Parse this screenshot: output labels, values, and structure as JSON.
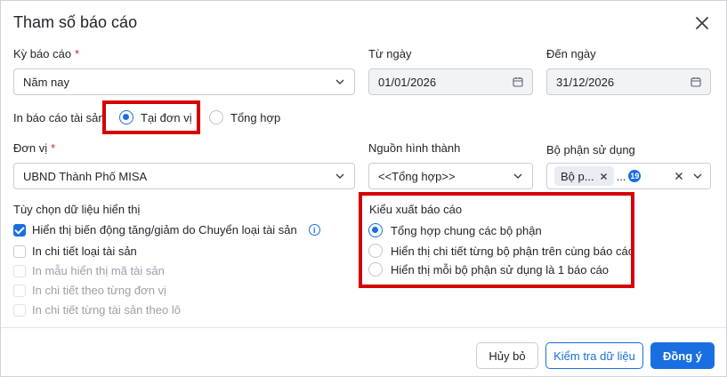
{
  "dialog": {
    "title": "Tham số báo cáo",
    "close_icon": "close-icon"
  },
  "ky_bao_cao": {
    "label": "Kỳ báo cáo",
    "required": "*",
    "value": "Năm nay"
  },
  "tu_ngay": {
    "label": "Từ ngày",
    "value": "01/01/2026",
    "icon": "calendar-icon"
  },
  "den_ngay": {
    "label": "Đến ngày",
    "value": "31/12/2026",
    "icon": "calendar-icon"
  },
  "in_bao_cao_tai_san": {
    "label": "In báo cáo tài sản",
    "options": [
      {
        "label": "Tại đơn vị",
        "selected": true
      },
      {
        "label": "Tổng hợp",
        "selected": false
      }
    ]
  },
  "don_vi": {
    "label": "Đơn vị",
    "required": "*",
    "value": "UBND Thành Phố MISA"
  },
  "nguon_hinh_thanh": {
    "label": "Nguồn hình thành",
    "value": "<<Tổng hợp>>"
  },
  "bo_phan_su_dung": {
    "label": "Bộ phận sử dụng",
    "tag": "Bộ p...",
    "more": "...",
    "count": "19"
  },
  "tuy_chon": {
    "label": "Tùy chọn dữ liệu hiển thị",
    "items": [
      {
        "label": "Hiển thị biến động tăng/giảm do Chuyển loại tài sản",
        "checked": true,
        "disabled": false
      },
      {
        "label": "In chi tiết loại tài sản",
        "checked": false,
        "disabled": false
      },
      {
        "label": "In mẫu hiển thị mã tài sản",
        "checked": false,
        "disabled": true
      },
      {
        "label": "In chi tiết theo từng đơn vị",
        "checked": false,
        "disabled": true
      },
      {
        "label": "In chi tiết từng tài sản theo lô",
        "checked": false,
        "disabled": true
      }
    ]
  },
  "kieu_xuat": {
    "label": "Kiểu xuất báo cáo",
    "options": [
      {
        "label": "Tổng hợp chung các bộ phận",
        "selected": true
      },
      {
        "label": "Hiển thị chi tiết từng bộ phận trên cùng báo cáo",
        "selected": false
      },
      {
        "label": "Hiển thị mỗi bộ phận sử dụng là 1 báo cáo",
        "selected": false
      }
    ]
  },
  "footer": {
    "cancel": "Hủy bỏ",
    "check": "Kiểm tra dữ liệu",
    "ok": "Đồng ý"
  },
  "colors": {
    "accent": "#1a6fe0",
    "highlight": "#d60000",
    "required": "#d92020"
  }
}
